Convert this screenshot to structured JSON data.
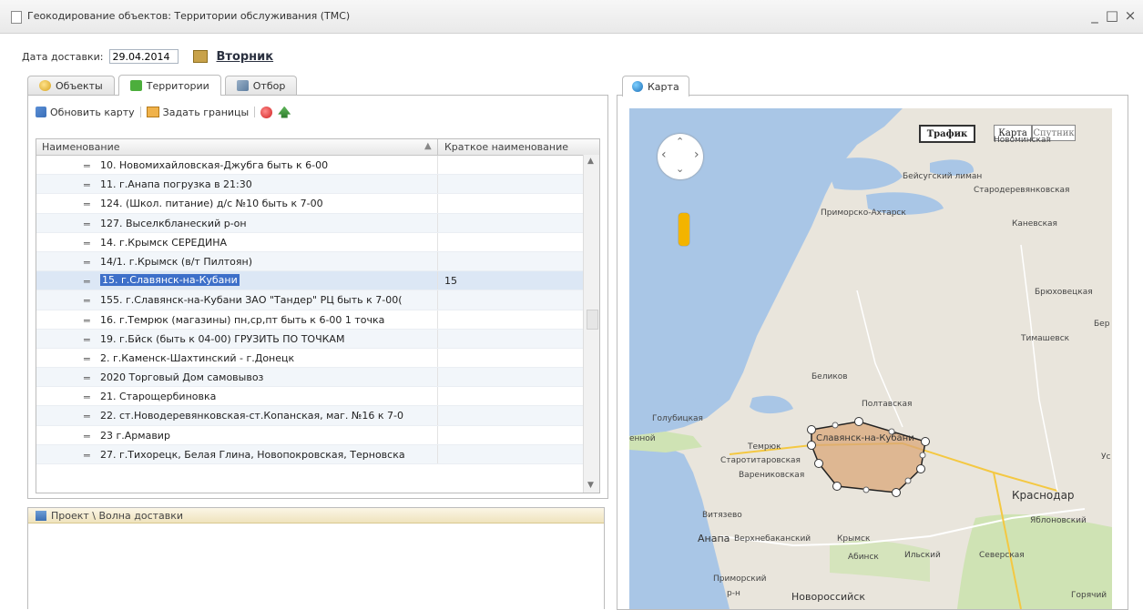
{
  "window": {
    "title": "Геокодирование объектов: Территории обслуживания (ТМС)",
    "controls": [
      "_",
      "□",
      "×"
    ]
  },
  "delivery": {
    "label": "Дата доставки:",
    "date": "29.04.2014",
    "day": "Вторник"
  },
  "tabs": [
    {
      "label": "Объекты",
      "icon": "objects-icon"
    },
    {
      "label": "Территории",
      "icon": "territories-icon"
    },
    {
      "label": "Отбор",
      "icon": "filter-icon"
    }
  ],
  "toolbar": {
    "refresh_label": "Обновить карту",
    "borders_label": "Задать границы"
  },
  "grid": {
    "columns": [
      "Наименование",
      "Краткое наименование"
    ],
    "rows": [
      {
        "name": "10. Новомихайловская-Джубга быть к 6-00",
        "short": ""
      },
      {
        "name": "11. г.Анапа погрузка в 21:30",
        "short": ""
      },
      {
        "name": "124. (Школ. питание) д/с №10 быть к 7-00",
        "short": ""
      },
      {
        "name": "127.  Выселкбланеский р-он",
        "short": ""
      },
      {
        "name": "14. г.Крымск СЕРЕДИНА",
        "short": ""
      },
      {
        "name": "14/1. г.Крымск (в/т Пилтоян)",
        "short": ""
      },
      {
        "name": "15. г.Славянск-на-Кубани",
        "short": "15",
        "selected": true
      },
      {
        "name": "155. г.Славянск-на-Кубани ЗАО \"Тандер\" РЦ быть к 7-00(",
        "short": ""
      },
      {
        "name": "16. г.Темрюк (магазины) пн,ср,пт быть к 6-00 1 точка",
        "short": ""
      },
      {
        "name": "19. г.Бйск (быть к 04-00) ГРУЗИТЬ ПО ТОЧКАМ",
        "short": ""
      },
      {
        "name": "2. г.Каменск-Шахтинский - г.Донецк",
        "short": ""
      },
      {
        "name": "2020 Торговый Дом самовывоз",
        "short": ""
      },
      {
        "name": "21. Старощербиновка",
        "short": ""
      },
      {
        "name": "22. ст.Новодеревянковская-ст.Копанская, маг. №16 к 7-0",
        "short": ""
      },
      {
        "name": "23 г.Армавир",
        "short": ""
      },
      {
        "name": "27. г.Тихорецк, Белая Глина, Новопокровская, Терновска",
        "short": ""
      }
    ]
  },
  "bottom_panel": {
    "header": "Проект \\ Волна доставки"
  },
  "map_tab": {
    "label": "Карта"
  },
  "map": {
    "traffic_btn": "Трафик",
    "map_btn": "Карта",
    "satellite_btn": "Спутник",
    "polygon_label": "Славянск-на-Кубани",
    "labels": [
      "Новоминская",
      "Бейсугский лиман",
      "Стародеревянковская",
      "Приморско-Ахтарск",
      "Каневская",
      "Брюховецкая",
      "Бер",
      "Тимашевск",
      "Беликов",
      "Полтавская",
      "Голубицкая",
      "Темрюк",
      "Старотитаровская",
      "Варениковская",
      "Ус",
      "Краснодар",
      "Витязево",
      "Яблоновский",
      "Анапа",
      "Верхнебаканский",
      "Крымск",
      "Абинск",
      "Ильский",
      "Северская",
      "Приморский",
      "р-н",
      "Новороссийск",
      "Горячий",
      "енной"
    ],
    "colors": {
      "sea": "#a9c6e6",
      "land": "#e9e5dc",
      "green": "#cfe3b4",
      "polygon": "#d9a77a"
    }
  }
}
